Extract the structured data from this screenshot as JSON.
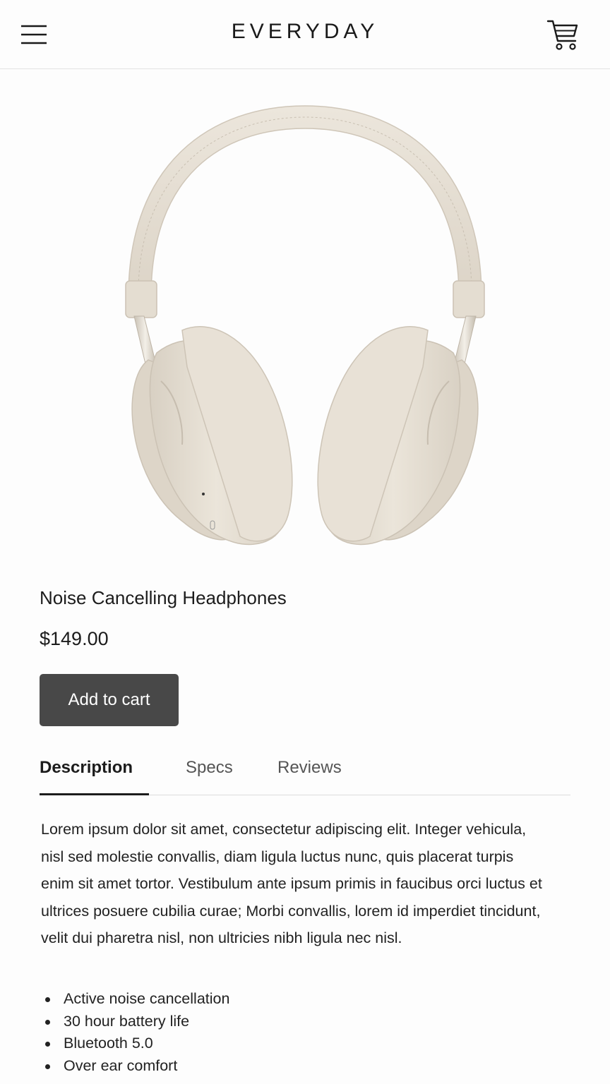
{
  "header": {
    "brand": "EVERYDAY",
    "menu_icon": "hamburger-menu-icon",
    "cart_icon": "shopping-cart-icon"
  },
  "product": {
    "image_alt": "Noise Cancelling Headphones",
    "name": "Noise Cancelling Headphones",
    "price": "$149.00",
    "add_to_cart_label": "Add to cart"
  },
  "tabs": [
    {
      "label": "Description",
      "active": true
    },
    {
      "label": "Specs",
      "active": false
    },
    {
      "label": "Reviews",
      "active": false
    }
  ],
  "description": {
    "text": "Lorem ipsum dolor sit amet, consectetur adipiscing elit. Integer vehicula, nisl sed molestie convallis, diam ligula luctus nunc, quis placerat turpis enim sit amet tortor. Vestibulum ante ipsum primis in faucibus orci luctus et ultrices posuere cubilia curae; Morbi convallis, lorem id imperdiet tincidunt, velit dui pharetra nisl, non ultricies nibh ligula nec nisl.",
    "features": [
      "Active noise cancellation",
      "30 hour battery life",
      "Bluetooth 5.0",
      "Over ear comfort"
    ]
  },
  "colors": {
    "button_bg": "#484848",
    "headphone": "#e6dfd3",
    "accent_text": "#1c1c1c"
  }
}
